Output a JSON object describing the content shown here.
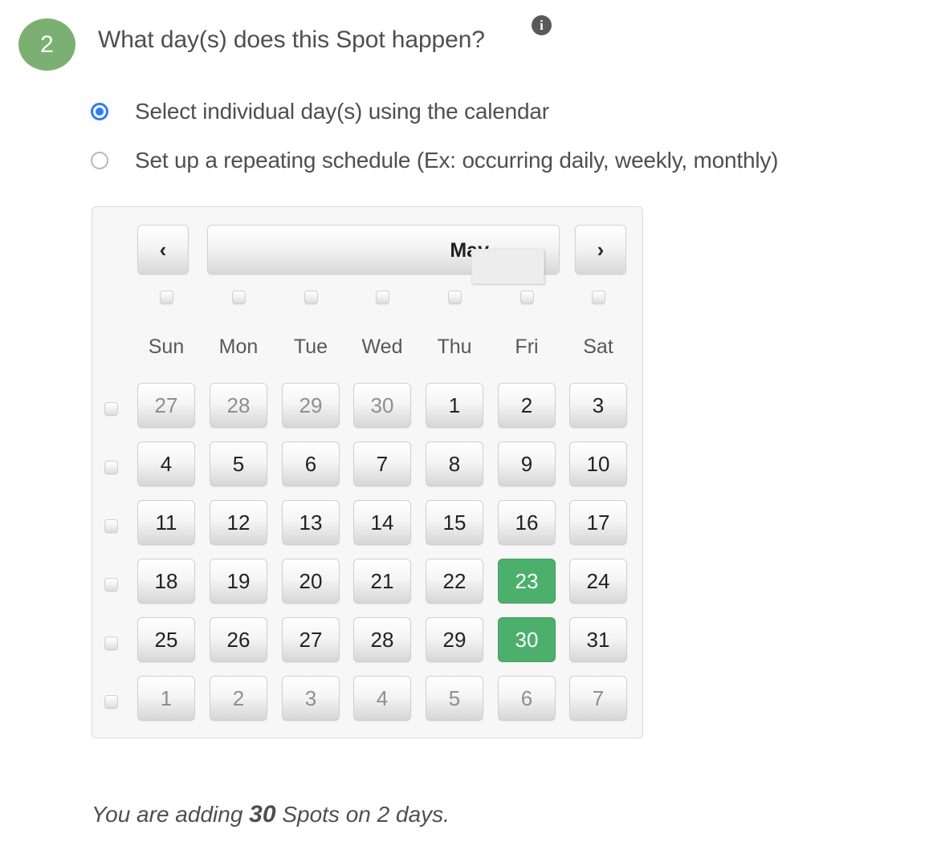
{
  "question": {
    "step_number": "2",
    "text": "What day(s) does this Spot happen?",
    "info_icon": "info-icon",
    "info_glyph": "i"
  },
  "mode_options": [
    {
      "label": "Select individual day(s) using the calendar",
      "selected": true
    },
    {
      "label": "Set up a repeating schedule (Ex: occurring daily, weekly, monthly)",
      "selected": false
    }
  ],
  "calendar": {
    "prev_label": "‹",
    "next_label": "›",
    "prev_icon": "chevron-left-icon",
    "next_icon": "chevron-right-icon",
    "month": "May",
    "year_value": "",
    "year_placeholder": "",
    "weekdays": [
      "Sun",
      "Mon",
      "Tue",
      "Wed",
      "Thu",
      "Fri",
      "Sat"
    ],
    "weeks": [
      {
        "days": [
          {
            "label": "27",
            "muted": true,
            "selected": false
          },
          {
            "label": "28",
            "muted": true,
            "selected": false
          },
          {
            "label": "29",
            "muted": true,
            "selected": false
          },
          {
            "label": "30",
            "muted": true,
            "selected": false
          },
          {
            "label": "1",
            "muted": false,
            "selected": false
          },
          {
            "label": "2",
            "muted": false,
            "selected": false
          },
          {
            "label": "3",
            "muted": false,
            "selected": false
          }
        ]
      },
      {
        "days": [
          {
            "label": "4",
            "muted": false,
            "selected": false
          },
          {
            "label": "5",
            "muted": false,
            "selected": false
          },
          {
            "label": "6",
            "muted": false,
            "selected": false
          },
          {
            "label": "7",
            "muted": false,
            "selected": false
          },
          {
            "label": "8",
            "muted": false,
            "selected": false
          },
          {
            "label": "9",
            "muted": false,
            "selected": false
          },
          {
            "label": "10",
            "muted": false,
            "selected": false
          }
        ]
      },
      {
        "days": [
          {
            "label": "11",
            "muted": false,
            "selected": false
          },
          {
            "label": "12",
            "muted": false,
            "selected": false
          },
          {
            "label": "13",
            "muted": false,
            "selected": false
          },
          {
            "label": "14",
            "muted": false,
            "selected": false
          },
          {
            "label": "15",
            "muted": false,
            "selected": false
          },
          {
            "label": "16",
            "muted": false,
            "selected": false
          },
          {
            "label": "17",
            "muted": false,
            "selected": false
          }
        ]
      },
      {
        "days": [
          {
            "label": "18",
            "muted": false,
            "selected": false
          },
          {
            "label": "19",
            "muted": false,
            "selected": false
          },
          {
            "label": "20",
            "muted": false,
            "selected": false
          },
          {
            "label": "21",
            "muted": false,
            "selected": false
          },
          {
            "label": "22",
            "muted": false,
            "selected": false
          },
          {
            "label": "23",
            "muted": false,
            "selected": true
          },
          {
            "label": "24",
            "muted": false,
            "selected": false
          }
        ]
      },
      {
        "days": [
          {
            "label": "25",
            "muted": false,
            "selected": false
          },
          {
            "label": "26",
            "muted": false,
            "selected": false
          },
          {
            "label": "27",
            "muted": false,
            "selected": false
          },
          {
            "label": "28",
            "muted": false,
            "selected": false
          },
          {
            "label": "29",
            "muted": false,
            "selected": false
          },
          {
            "label": "30",
            "muted": false,
            "selected": true
          },
          {
            "label": "31",
            "muted": false,
            "selected": false
          }
        ]
      },
      {
        "days": [
          {
            "label": "1",
            "muted": true,
            "selected": false
          },
          {
            "label": "2",
            "muted": true,
            "selected": false
          },
          {
            "label": "3",
            "muted": true,
            "selected": false
          },
          {
            "label": "4",
            "muted": true,
            "selected": false
          },
          {
            "label": "5",
            "muted": true,
            "selected": false
          },
          {
            "label": "6",
            "muted": true,
            "selected": false
          },
          {
            "label": "7",
            "muted": true,
            "selected": false
          }
        ]
      }
    ]
  },
  "summary": {
    "prefix": "You are adding ",
    "count": "30",
    "middle": " Spots on ",
    "days": "2",
    "suffix": " days."
  },
  "colors": {
    "step_badge_green": "#7cb072",
    "selected_day_green": "#4caf6b",
    "radio_blue": "#2f7bf6",
    "info_grey": "#595959",
    "calendar_bg": "#f7f7f7",
    "text": "#4f4f4f"
  }
}
